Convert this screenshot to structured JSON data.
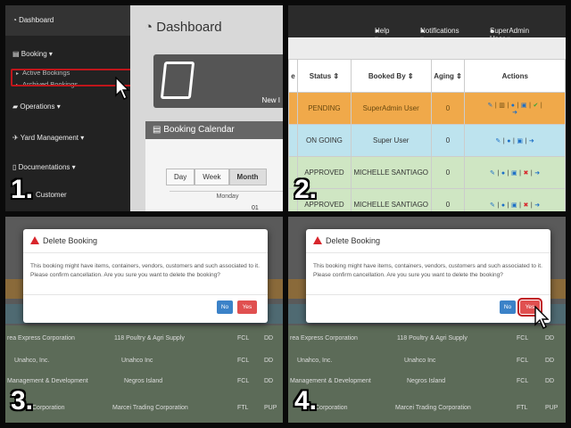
{
  "steps": [
    "1.",
    "2.",
    "3.",
    "4."
  ],
  "panel1": {
    "sidebar": {
      "dashboard": "Dashboard",
      "booking": "Booking ▾",
      "sub_active": "Active Bookings",
      "sub_archived": "Archived Bookings",
      "operations": "Operations ▾",
      "yard": "Yard Management ▾",
      "docs": "Documentations ▾",
      "customer": "Customer"
    },
    "title": "Dashboard",
    "card_new": "New I",
    "calendar_title": "Booking Calendar",
    "views": [
      "Day",
      "Week",
      "Month"
    ],
    "monday": "Monday",
    "day_num": "01"
  },
  "panel2": {
    "topbar": {
      "help": "Help ▾",
      "notifications": "Notifications ▾",
      "user": "SuperAdmin User ▾"
    },
    "headers": [
      "e",
      "Status ⇕",
      "Booked By ⇕",
      "Aging ⇕",
      "Actions"
    ],
    "rows": [
      {
        "status": "PENDING",
        "booked_by": "SuperAdmin User",
        "aging": "0"
      },
      {
        "status": "ON GOING",
        "booked_by": "Super User",
        "aging": "0"
      },
      {
        "status": "APPROVED",
        "booked_by": "MICHELLE SANTIAGO",
        "aging": "0"
      },
      {
        "status": "APPROVED",
        "booked_by": "MICHELLE SANTIAGO",
        "aging": "0"
      }
    ]
  },
  "modal": {
    "title": "Delete Booking",
    "body": "This booking might have items, containers, vendors, customers and such associated to it. Please confirm cancellation. Are you sure you want to delete the booking?",
    "no": "No",
    "yes": "Yes"
  },
  "bg_rows": [
    {
      "col1": "rea Express Corporation",
      "col2": "118 Poultry & Agri Supply",
      "col4": "FCL",
      "col5": "DD"
    },
    {
      "col1": "Unahco, Inc.",
      "col2": "Unahco Inc",
      "col4": "FCL",
      "col5": "DD"
    },
    {
      "col1": "Management & Development",
      "col2": "Negros Island",
      "col4": "FCL",
      "col5": "DD"
    },
    {
      "col1": "Corporation",
      "col2": "Marcei Trading Corporation",
      "col4": "FTL",
      "col5": "PUP"
    }
  ]
}
